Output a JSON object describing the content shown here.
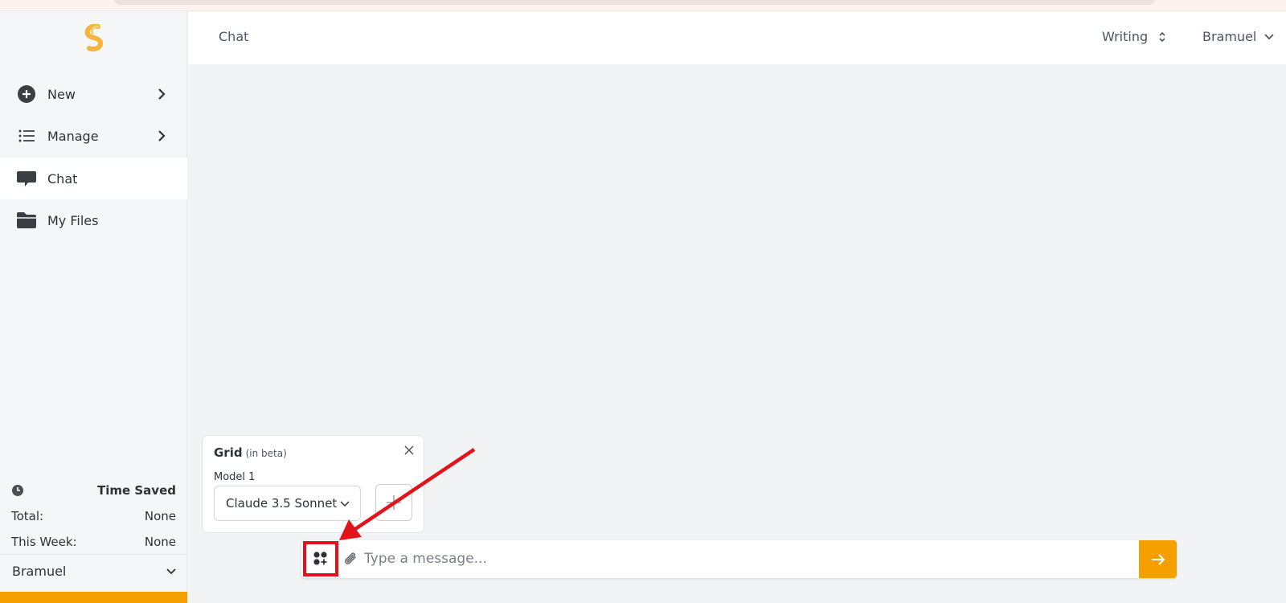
{
  "sidebar": {
    "items": [
      {
        "label": "New",
        "icon": "plus-circle-icon"
      },
      {
        "label": "Manage",
        "icon": "list-icon"
      },
      {
        "label": "Chat",
        "icon": "chat-bubble-icon"
      },
      {
        "label": "My Files",
        "icon": "folder-icon"
      }
    ],
    "time_saved": {
      "title": "Time Saved",
      "total_label": "Total:",
      "total_value": "None",
      "week_label": "This Week:",
      "week_value": "None"
    },
    "user": "Bramuel"
  },
  "header": {
    "title": "Chat",
    "mode": "Writing",
    "user": "Bramuel"
  },
  "grid_panel": {
    "title": "Grid",
    "beta": "(in beta)",
    "model_label": "Model 1",
    "model_value": "Claude 3.5 Sonnet"
  },
  "composer": {
    "placeholder": "Type a message..."
  },
  "colors": {
    "accent": "#f5a000",
    "highlight": "#e2131b"
  }
}
